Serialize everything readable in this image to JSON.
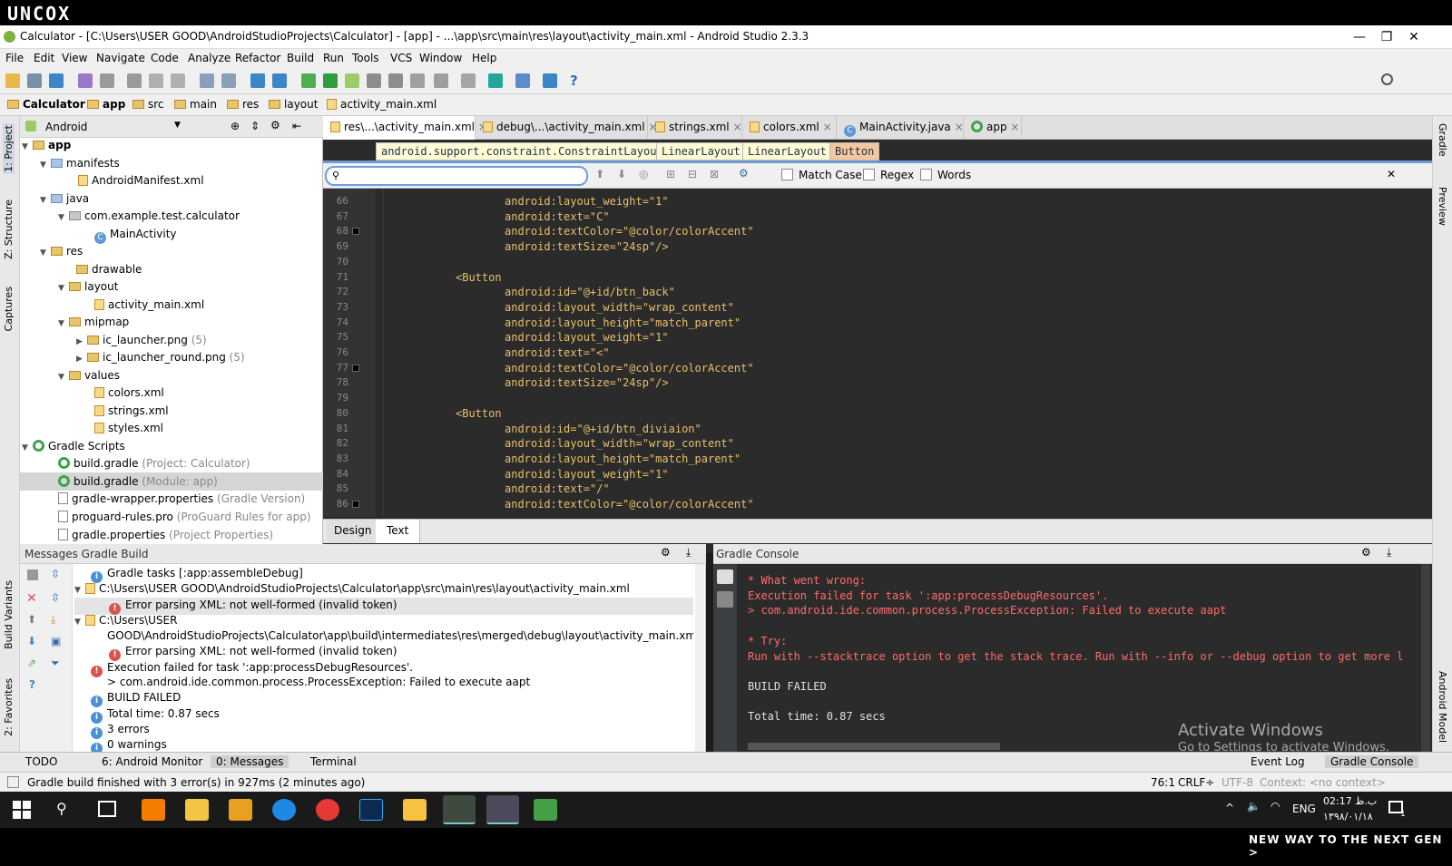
{
  "overlay": {
    "logo": "UNCOX",
    "tagline": "NEW WAY TO THE NEXT GEN >"
  },
  "window": {
    "title": "Calculator - [C:\\Users\\USER GOOD\\AndroidStudioProjects\\Calculator] - [app] - ...\\app\\src\\main\\res\\layout\\activity_main.xml - Android Studio 2.3.3",
    "minimize": "—",
    "maximize": "❐",
    "close": "✕"
  },
  "menu": [
    "File",
    "Edit",
    "View",
    "Navigate",
    "Code",
    "Analyze",
    "Refactor",
    "Build",
    "Run",
    "Tools",
    "VCS",
    "Window",
    "Help"
  ],
  "breadcrumb": [
    "Calculator",
    "app",
    "src",
    "main",
    "res",
    "layout",
    "activity_main.xml"
  ],
  "side_left": {
    "project": "1: Project",
    "structure": "Z: Structure",
    "captures": "Captures",
    "build_variants": "Build Variants",
    "favorites": "2: Favorites"
  },
  "side_right": {
    "gradle": "Gradle",
    "preview": "Preview",
    "android_model": "Android Model"
  },
  "project": {
    "view": "Android",
    "tree": [
      {
        "label": "app",
        "extra": ""
      },
      {
        "label": "manifests",
        "extra": ""
      },
      {
        "label": "AndroidManifest.xml",
        "extra": ""
      },
      {
        "label": "java",
        "extra": ""
      },
      {
        "label": "com.example.test.calculator",
        "extra": ""
      },
      {
        "label": "MainActivity",
        "extra": ""
      },
      {
        "label": "res",
        "extra": ""
      },
      {
        "label": "drawable",
        "extra": ""
      },
      {
        "label": "layout",
        "extra": ""
      },
      {
        "label": "activity_main.xml",
        "extra": ""
      },
      {
        "label": "mipmap",
        "extra": ""
      },
      {
        "label": "ic_launcher.png",
        "extra": "(5)"
      },
      {
        "label": "ic_launcher_round.png",
        "extra": "(5)"
      },
      {
        "label": "values",
        "extra": ""
      },
      {
        "label": "colors.xml",
        "extra": ""
      },
      {
        "label": "strings.xml",
        "extra": ""
      },
      {
        "label": "styles.xml",
        "extra": ""
      },
      {
        "label": "Gradle Scripts",
        "extra": ""
      },
      {
        "label": "build.gradle",
        "extra": "(Project: Calculator)"
      },
      {
        "label": "build.gradle",
        "extra": "(Module: app)"
      },
      {
        "label": "gradle-wrapper.properties",
        "extra": "(Gradle Version)"
      },
      {
        "label": "proguard-rules.pro",
        "extra": "(ProGuard Rules for app)"
      },
      {
        "label": "gradle.properties",
        "extra": "(Project Properties)"
      }
    ]
  },
  "editor_tabs": [
    "res\\...\\activity_main.xml",
    "debug\\...\\activity_main.xml",
    "strings.xml",
    "colors.xml",
    "MainActivity.java",
    "app"
  ],
  "xml_crumbs": [
    "android.support.constraint.ConstraintLayout",
    "LinearLayout",
    "LinearLayout",
    "Button"
  ],
  "find": {
    "query": "",
    "match_case": "Match Case",
    "regex": "Regex",
    "words": "Words"
  },
  "code": {
    "lines": [
      {
        "n": "66",
        "a": "android:layout_weight=",
        "v": "\"1\""
      },
      {
        "n": "67",
        "a": "android:text=",
        "v": "\"C\""
      },
      {
        "n": "68",
        "a": "android:textColor=",
        "v": "\"@color/colorAccent\""
      },
      {
        "n": "69",
        "a": "android:textSize=",
        "v": "\"24sp\"/>"
      },
      {
        "n": "70",
        "a": "",
        "v": ""
      },
      {
        "n": "71",
        "tag": "<Button"
      },
      {
        "n": "72",
        "a": "android:id=",
        "v": "\"@+id/btn_back\""
      },
      {
        "n": "73",
        "a": "android:layout_width=",
        "v": "\"wrap_content\""
      },
      {
        "n": "74",
        "a": "android:layout_height=",
        "v": "\"match_parent\""
      },
      {
        "n": "75",
        "a": "android:layout_weight=",
        "v": "\"1\""
      },
      {
        "n": "76",
        "a": "android:text=",
        "v": "\"<\""
      },
      {
        "n": "77",
        "a": "android:textColor=",
        "v": "\"@color/colorAccent\""
      },
      {
        "n": "78",
        "a": "android:textSize=",
        "v": "\"24sp\"/>"
      },
      {
        "n": "79",
        "a": "",
        "v": ""
      },
      {
        "n": "80",
        "tag": "<Button"
      },
      {
        "n": "81",
        "a": "android:id=",
        "v": "\"@+id/btn_diviaion\""
      },
      {
        "n": "82",
        "a": "android:layout_width=",
        "v": "\"wrap_content\""
      },
      {
        "n": "83",
        "a": "android:layout_height=",
        "v": "\"match_parent\""
      },
      {
        "n": "84",
        "a": "android:layout_weight=",
        "v": "\"1\""
      },
      {
        "n": "85",
        "a": "android:text=",
        "v": "\"/\""
      },
      {
        "n": "86",
        "a": "android:textColor=",
        "v": "\"@color/colorAccent\""
      }
    ]
  },
  "design_tabs": [
    "Design",
    "Text"
  ],
  "messages": {
    "title": "Messages Gradle Build",
    "rows": [
      {
        "kind": "info",
        "text": "Gradle tasks [:app:assembleDebug]"
      },
      {
        "kind": "path",
        "text": "C:\\Users\\USER GOOD\\AndroidStudioProjects\\Calculator\\app\\src\\main\\res\\layout\\activity_main.xml"
      },
      {
        "kind": "err",
        "text": "Error parsing XML: not well-formed (invalid token)"
      },
      {
        "kind": "path",
        "text": "C:\\Users\\USER"
      },
      {
        "kind": "none",
        "text": "GOOD\\AndroidStudioProjects\\Calculator\\app\\build\\intermediates\\res\\merged\\debug\\layout\\activity_main.xml"
      },
      {
        "kind": "err",
        "text": "Error parsing XML: not well-formed (invalid token)"
      },
      {
        "kind": "err",
        "text": "Execution failed for task ':app:processDebugResources'."
      },
      {
        "kind": "none",
        "text": "> com.android.ide.common.process.ProcessException: Failed to execute aapt"
      },
      {
        "kind": "info",
        "text": "BUILD FAILED"
      },
      {
        "kind": "info",
        "text": "Total time: 0.87 secs"
      },
      {
        "kind": "info",
        "text": "3 errors"
      },
      {
        "kind": "info",
        "text": "0 warnings"
      }
    ]
  },
  "console": {
    "title": "Gradle Console",
    "lines": [
      {
        "t": "* What went wrong:",
        "c": "red"
      },
      {
        "t": "Execution failed for task ':app:processDebugResources'.",
        "c": "red"
      },
      {
        "t": "> com.android.ide.common.process.ProcessException: Failed to execute aapt",
        "c": "red"
      },
      {
        "t": "",
        "c": "red"
      },
      {
        "t": "* Try:",
        "c": "red"
      },
      {
        "t": "Run with --stacktrace option to get the stack trace. Run with --info or --debug option to get more log ou",
        "c": "red"
      },
      {
        "t": "",
        "c": "red"
      },
      {
        "t": "BUILD FAILED",
        "c": "white"
      },
      {
        "t": "",
        "c": "white"
      },
      {
        "t": "Total time: 0.87 secs",
        "c": "white"
      }
    ],
    "watermark1": "Activate Windows",
    "watermark2": "Go to Settings to activate Windows."
  },
  "bottom_tabs": {
    "todo": "TODO",
    "monitor": "6: Android Monitor",
    "messages": "0: Messages",
    "terminal": "Terminal",
    "event_log": "Event Log",
    "gradle_console": "Gradle Console"
  },
  "status": {
    "text": "Gradle build finished with 3 error(s) in 927ms (2 minutes ago)",
    "pos": "76:1",
    "crlf": "CRLF÷",
    "enc": "UTF-8",
    "context": "Context: <no context>"
  },
  "taskbar": {
    "lang": "ENG",
    "time": "02:17 ب.ظ",
    "date": "۱۳۹۸/۰۱/۱۸",
    "notif": "1"
  },
  "colors": {
    "accent": "#6e9bd2",
    "error": "#d9534f",
    "info": "#4a90d9",
    "editor_bg": "#2b2b2b"
  }
}
